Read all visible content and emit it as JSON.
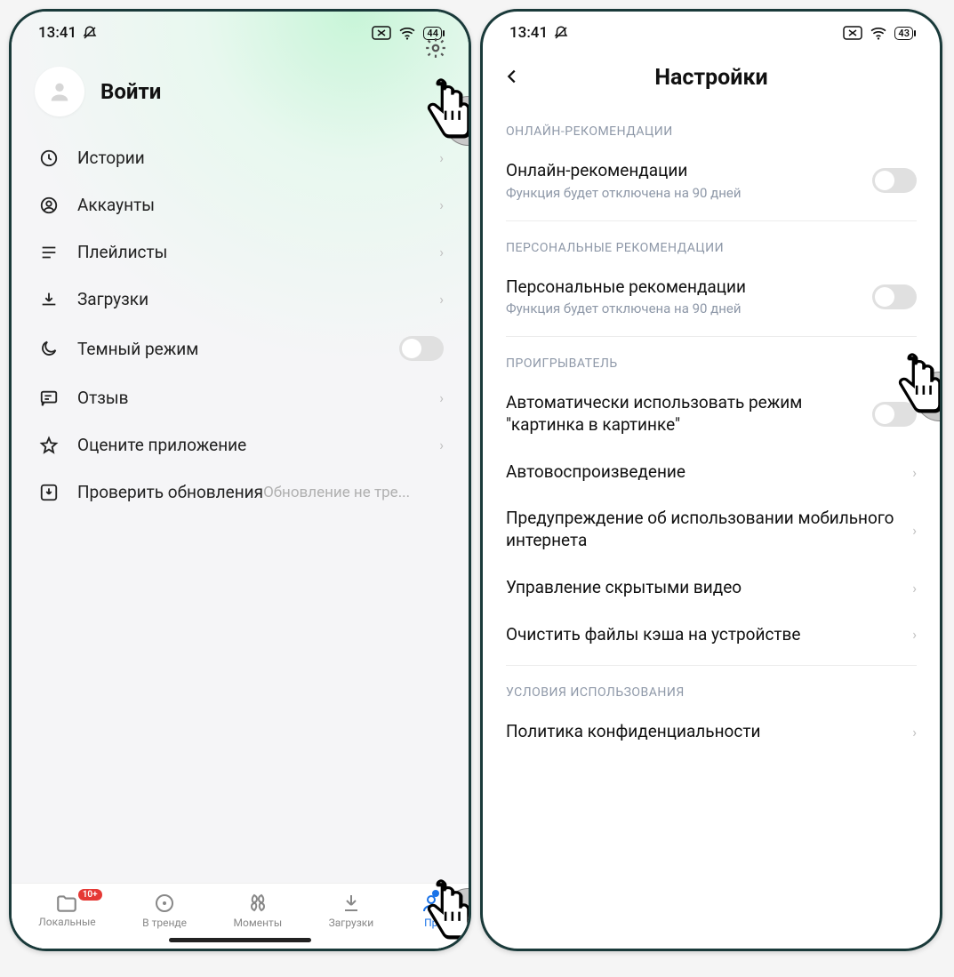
{
  "status": {
    "time": "13:41",
    "battery1": "44",
    "battery2": "43"
  },
  "left": {
    "login": "Войти",
    "menu": [
      {
        "label": "Истории"
      },
      {
        "label": "Аккаунты"
      },
      {
        "label": "Плейлисты"
      },
      {
        "label": "Загрузки"
      },
      {
        "label": "Темный режим"
      },
      {
        "label": "Отзыв"
      },
      {
        "label": "Оцените приложение"
      },
      {
        "label": "Проверить обновления",
        "sub": "Обновление не тре..."
      }
    ],
    "nav": {
      "badge": "10+",
      "items": [
        "Локальные",
        "В тренде",
        "Моменты",
        "Загрузки",
        "Пр"
      ]
    }
  },
  "right": {
    "title": "Настройки",
    "sections": {
      "online": {
        "header": "ОНЛАЙН-РЕКОМЕНДАЦИИ",
        "item_title": "Онлайн-рекомендации",
        "item_sub": "Функция будет отключена на 90 дней"
      },
      "personal": {
        "header": "ПЕРСОНАЛЬНЫЕ РЕКОМЕНДАЦИИ",
        "item_title": "Персональные рекомендации",
        "item_sub": "Функция будет отключена на 90 дней"
      },
      "player": {
        "header": "ПРОИГРЫВАТЕЛЬ",
        "pip": "Автоматически использовать режим \"картинка в картинке\"",
        "autoplay": "Автовоспроизведение",
        "mobile": "Предупреждение об использовании мобильного интернета",
        "hidden": "Управление скрытыми видео",
        "cache": "Очистить файлы кэша на устройстве"
      },
      "terms": {
        "header": "УСЛОВИЯ ИСПОЛЬЗОВАНИЯ",
        "privacy": "Политика конфиденциальности"
      }
    }
  }
}
